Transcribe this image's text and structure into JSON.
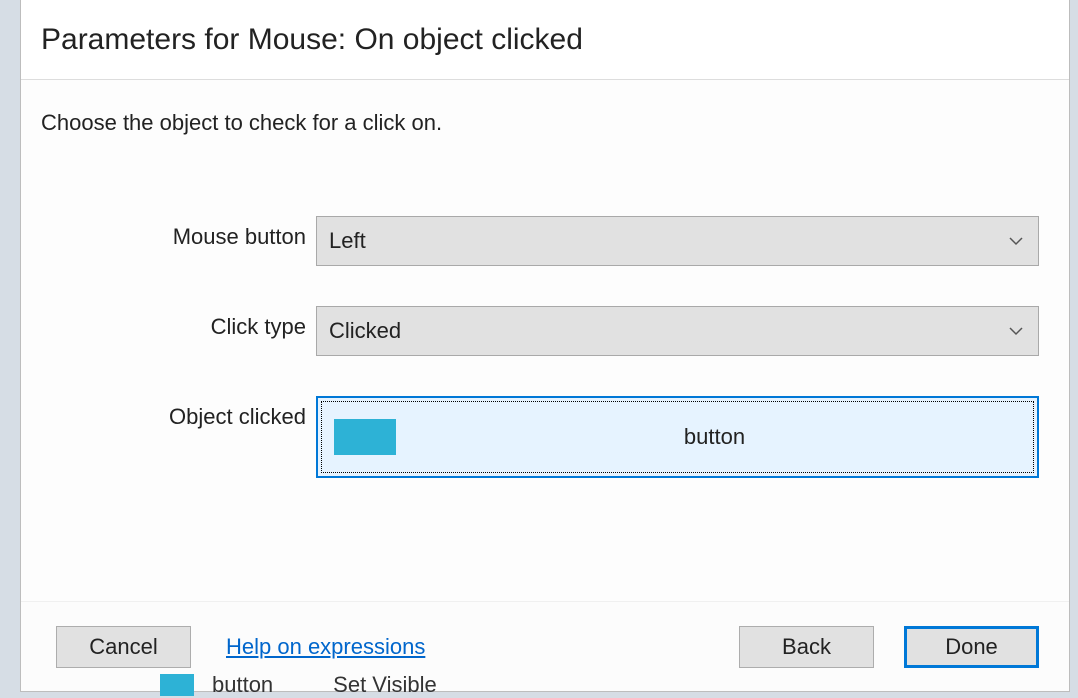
{
  "dialog": {
    "title": "Parameters for Mouse: On object clicked",
    "instruction": "Choose the object to check for a click on."
  },
  "fields": {
    "mouse_button": {
      "label": "Mouse button",
      "value": "Left"
    },
    "click_type": {
      "label": "Click type",
      "value": "Clicked"
    },
    "object_clicked": {
      "label": "Object clicked",
      "value": "button",
      "swatch_color": "#2db2d6"
    }
  },
  "footer": {
    "cancel": "Cancel",
    "help": "Help on expressions",
    "back": "Back",
    "done": "Done"
  },
  "background_hint": {
    "item1": "button",
    "item2": "Set Visible"
  }
}
